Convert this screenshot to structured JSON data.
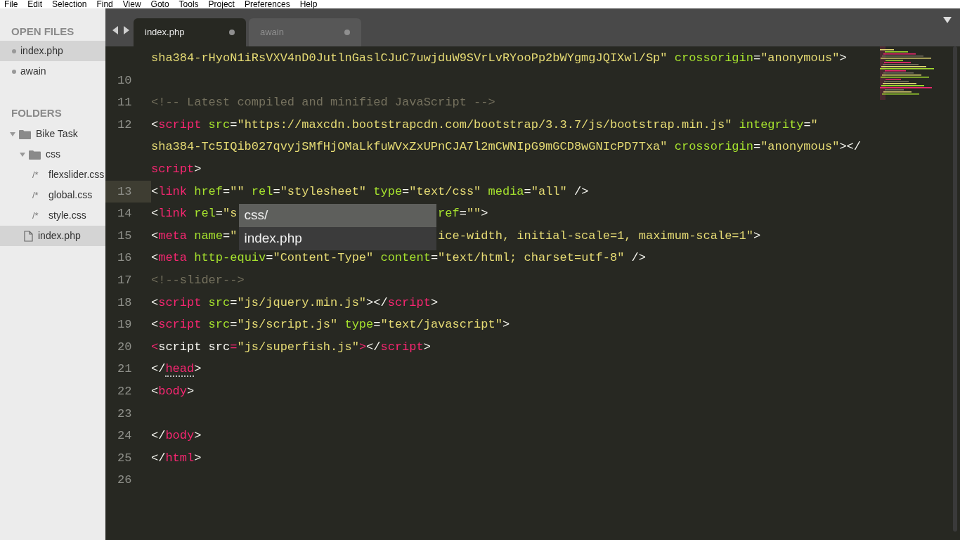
{
  "menu_bar": [
    "File",
    "Edit",
    "Selection",
    "Find",
    "View",
    "Goto",
    "Tools",
    "Project",
    "Preferences",
    "Help"
  ],
  "sidebar": {
    "open_files_title": "OPEN FILES",
    "open_files": [
      {
        "label": "index.php",
        "selected": true
      },
      {
        "label": "awain",
        "selected": false
      }
    ],
    "folders_title": "FOLDERS",
    "folders": [
      {
        "kind": "folder",
        "label": "Bike Task",
        "expanded": true,
        "selected": false,
        "children": [
          {
            "kind": "folder",
            "label": "css",
            "expanded": true,
            "selected": false,
            "children": [
              {
                "kind": "file",
                "glyph": "/*",
                "label": "flexslider.css",
                "selected": false
              },
              {
                "kind": "file",
                "glyph": "/*",
                "label": "global.css",
                "selected": false
              },
              {
                "kind": "file",
                "glyph": "/*",
                "label": "style.css",
                "selected": false
              }
            ]
          },
          {
            "kind": "file",
            "label": "index.php",
            "selected": true
          }
        ]
      }
    ]
  },
  "tabs": [
    {
      "label": "index.php",
      "selected": true,
      "modified": true
    },
    {
      "label": "awain",
      "selected": false,
      "modified": true
    }
  ],
  "autocomplete": [
    {
      "label": "css/",
      "selected": true
    },
    {
      "label": "index.php",
      "selected": false
    }
  ],
  "lines": [
    {
      "current": false,
      "segments": [
        {
          "kind": "string",
          "text": "sha384-rHyoN1iRsVXV4nD0JutlnGaslCJuC7uwjduW9SVrLvRYooPp2bWYgmgJQIXwl/Sp\""
        },
        {
          "kind": "attr",
          "text": " crossorigin"
        },
        {
          "kind": "punct",
          "text": "="
        },
        {
          "kind": "string",
          "text": "\"anonymous\""
        },
        {
          "kind": "punct",
          "text": ">"
        }
      ]
    },
    {
      "number": "10",
      "current": false
    },
    {
      "number": "11",
      "current": false,
      "segments": [
        {
          "kind": "comment",
          "text": "<!-- Latest compiled and minified JavaScript -->"
        }
      ]
    },
    {
      "number": "12",
      "current": false,
      "segments": [
        {
          "kind": "punct",
          "text": "<"
        },
        {
          "kind": "tag",
          "text": "script"
        },
        {
          "kind": "attr",
          "text": " src"
        },
        {
          "kind": "punct",
          "text": "="
        },
        {
          "kind": "string",
          "text": "\"https://maxcdn.bootstrapcdn.com/bootstrap/3.3.7/js/bootstrap.min.js\""
        },
        {
          "kind": "attr",
          "text": " integrity"
        },
        {
          "kind": "punct",
          "text": "="
        },
        {
          "kind": "string",
          "text": "\""
        }
      ]
    },
    {
      "current": false,
      "segments": [
        {
          "kind": "string",
          "text": "sha384-Tc5IQib027qvyjSMfHjOMaLkfuWVxZxUPnCJA7l2mCWNIpG9mGCD8wGNIcPD7Txa\""
        },
        {
          "kind": "attr",
          "text": " crossorigin"
        },
        {
          "kind": "punct",
          "text": "="
        },
        {
          "kind": "string",
          "text": "\"anonymous\""
        },
        {
          "kind": "punct",
          "text": "></"
        }
      ]
    },
    {
      "current": false,
      "segments": [
        {
          "kind": "tag",
          "text": "script"
        },
        {
          "kind": "punct",
          "text": ">"
        }
      ]
    },
    {
      "number": "13",
      "current": true,
      "segments": [
        {
          "kind": "punct",
          "text": "<"
        },
        {
          "kind": "tag",
          "text": "link"
        },
        {
          "kind": "attr",
          "text": " href"
        },
        {
          "kind": "punct",
          "text": "="
        },
        {
          "kind": "string",
          "text": "\"\""
        },
        {
          "kind": "attr",
          "text": " rel"
        },
        {
          "kind": "punct",
          "text": "="
        },
        {
          "kind": "string",
          "text": "\"stylesheet\""
        },
        {
          "kind": "attr",
          "text": " type"
        },
        {
          "kind": "punct",
          "text": "="
        },
        {
          "kind": "string",
          "text": "\"text/css\""
        },
        {
          "kind": "attr",
          "text": " media"
        },
        {
          "kind": "punct",
          "text": "="
        },
        {
          "kind": "string",
          "text": "\"all\""
        },
        {
          "kind": "punct",
          "text": " />"
        }
      ]
    },
    {
      "number": "14",
      "current": false,
      "segments": [
        {
          "kind": "punct",
          "text": "<"
        },
        {
          "kind": "tag",
          "text": "link"
        },
        {
          "kind": "attr",
          "text": " rel"
        },
        {
          "kind": "punct",
          "text": "="
        },
        {
          "kind": "string",
          "text": "\"s"
        }
      ],
      "after": [
        {
          "kind": "attr",
          "text": "ref"
        },
        {
          "kind": "punct",
          "text": "="
        },
        {
          "kind": "string",
          "text": "\"\""
        },
        {
          "kind": "punct",
          "text": ">"
        }
      ]
    },
    {
      "number": "15",
      "current": false,
      "segments": [
        {
          "kind": "punct",
          "text": "<"
        },
        {
          "kind": "tag",
          "text": "meta"
        },
        {
          "kind": "attr",
          "text": " name"
        },
        {
          "kind": "punct",
          "text": "="
        },
        {
          "kind": "string",
          "text": "\""
        }
      ],
      "after": [
        {
          "kind": "string",
          "text": "ice-width, initial-scale=1, maximum-scale=1\""
        },
        {
          "kind": "punct",
          "text": ">"
        }
      ]
    },
    {
      "number": "16",
      "current": false,
      "segments": [
        {
          "kind": "punct",
          "text": "<"
        },
        {
          "kind": "tag",
          "text": "meta"
        },
        {
          "kind": "attr",
          "text": " http-equiv"
        },
        {
          "kind": "punct",
          "text": "="
        },
        {
          "kind": "string",
          "text": "\"Content-Type\""
        },
        {
          "kind": "attr",
          "text": " content"
        },
        {
          "kind": "punct",
          "text": "="
        },
        {
          "kind": "string",
          "text": "\"text/html; charset=utf-8\""
        },
        {
          "kind": "punct",
          "text": " />"
        }
      ]
    },
    {
      "number": "17",
      "current": false,
      "segments": [
        {
          "kind": "comment",
          "text": "<!--slider-->"
        }
      ]
    },
    {
      "number": "18",
      "current": false,
      "segments": [
        {
          "kind": "punct",
          "text": "<"
        },
        {
          "kind": "tag",
          "text": "script"
        },
        {
          "kind": "attr",
          "text": " src"
        },
        {
          "kind": "punct",
          "text": "="
        },
        {
          "kind": "string",
          "text": "\"js/jquery.min.js\""
        },
        {
          "kind": "punct",
          "text": "></"
        },
        {
          "kind": "tag",
          "text": "script"
        },
        {
          "kind": "punct",
          "text": ">"
        }
      ]
    },
    {
      "number": "19",
      "current": false,
      "segments": [
        {
          "kind": "punct",
          "text": "<"
        },
        {
          "kind": "tag",
          "text": "script"
        },
        {
          "kind": "attr",
          "text": " src"
        },
        {
          "kind": "punct",
          "text": "="
        },
        {
          "kind": "string",
          "text": "\"js/script.js\""
        },
        {
          "kind": "attr",
          "text": " type"
        },
        {
          "kind": "punct",
          "text": "="
        },
        {
          "kind": "string",
          "text": "\"text/javascript\""
        },
        {
          "kind": "punct",
          "text": ">"
        }
      ]
    },
    {
      "number": "20",
      "current": false,
      "segments": [
        {
          "kind": "tag",
          "text": "<"
        },
        {
          "kind": "plain",
          "text": "script src"
        },
        {
          "kind": "tag",
          "text": "="
        },
        {
          "kind": "string",
          "text": "\"js/superfish.js\""
        },
        {
          "kind": "tag",
          "text": ">"
        },
        {
          "kind": "punct",
          "text": "</"
        },
        {
          "kind": "tag",
          "text": "script"
        },
        {
          "kind": "punct",
          "text": ">"
        }
      ]
    },
    {
      "number": "21",
      "current": false,
      "segments": [
        {
          "kind": "punct",
          "text": "</"
        },
        {
          "kind": "tag",
          "text": "head",
          "underline": true
        },
        {
          "kind": "punct",
          "text": ">"
        }
      ]
    },
    {
      "number": "22",
      "current": false,
      "segments": [
        {
          "kind": "punct",
          "text": "<"
        },
        {
          "kind": "tag",
          "text": "body"
        },
        {
          "kind": "punct",
          "text": ">"
        }
      ]
    },
    {
      "number": "23",
      "current": false
    },
    {
      "number": "24",
      "current": false,
      "segments": [
        {
          "kind": "punct",
          "text": "</"
        },
        {
          "kind": "tag",
          "text": "body"
        },
        {
          "kind": "punct",
          "text": ">"
        }
      ]
    },
    {
      "number": "25",
      "current": false,
      "segments": [
        {
          "kind": "punct",
          "text": "</"
        },
        {
          "kind": "tag",
          "text": "html"
        },
        {
          "kind": "punct",
          "text": ">"
        }
      ]
    },
    {
      "number": "26",
      "current": false
    }
  ]
}
